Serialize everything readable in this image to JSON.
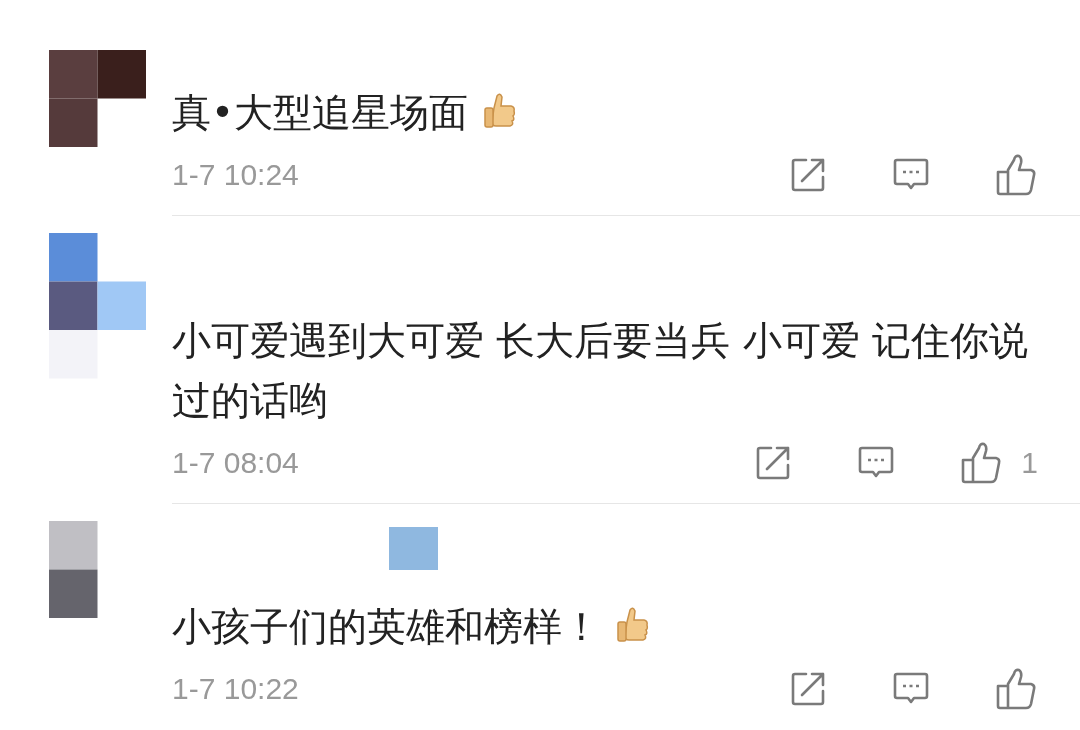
{
  "comments": [
    {
      "text": "真•大型追星场面",
      "thumbs_emoji": true,
      "time": "1-7 10:24"
    },
    {
      "text": "小可爱遇到大可爱 长大后要当兵 小可爱 记住你说过的话哟",
      "thumbs_emoji": false,
      "time": "1-7 08:04",
      "like_count": "1"
    },
    {
      "text": "小孩子们的英雄和榜样！",
      "thumbs_emoji": true,
      "time": "1-7 10:22"
    }
  ]
}
